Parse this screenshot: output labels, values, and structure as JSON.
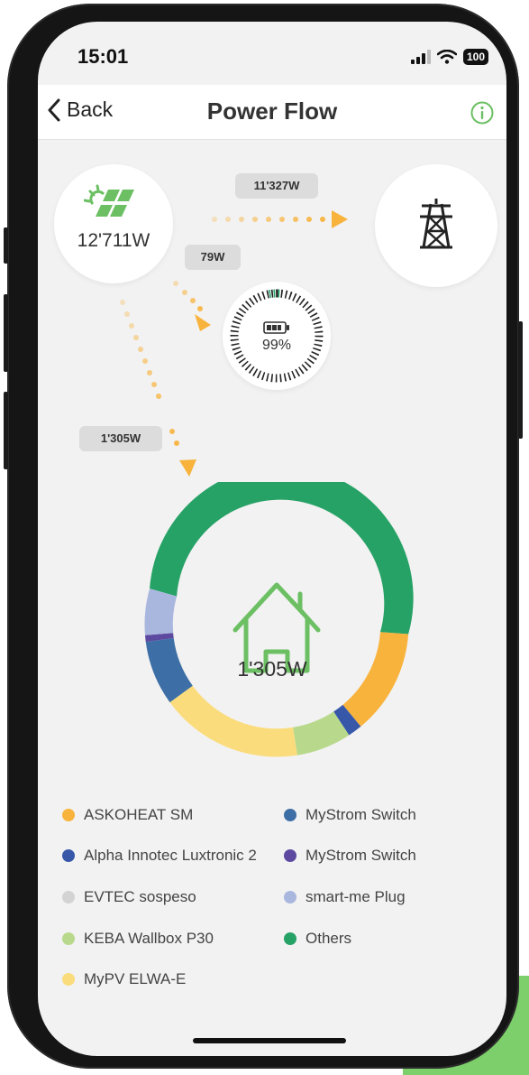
{
  "status_bar": {
    "time": "15:01",
    "battery": "100"
  },
  "nav": {
    "back_label": "Back",
    "title": "Power Flow"
  },
  "flow": {
    "solar_power": "12'711W",
    "to_grid": "11'327W",
    "to_battery": "79W",
    "to_house": "1'305W",
    "battery_level": "99%",
    "house_power": "1'305W"
  },
  "legend": {
    "askoheat": "ASKOHEAT SM",
    "alpha_innotec": "Alpha Innotec Luxtronic 2",
    "evtec": "EVTEC sospeso",
    "keba": "KEBA Wallbox P30",
    "mypv": "MyPV ELWA-E",
    "mystrom_1": "MyStrom Switch",
    "mystrom_2": "MyStrom Switch",
    "smartme": "smart-me Plug",
    "others": "Others"
  },
  "colors": {
    "askoheat": "#f8b33d",
    "alpha_innotec": "#3758a8",
    "evtec": "#d3d3d3",
    "keba": "#b8d98c",
    "mypv": "#fbdc7c",
    "mystrom_1": "#3d6fa6",
    "mystrom_2": "#5d4aa0",
    "smartme": "#a9b7df",
    "others": "#27a266",
    "flow_arrow": "#f8b33d",
    "house_icon": "#6cc063",
    "solar_icon": "#6cc063"
  },
  "icons": [
    "chevron-left-icon",
    "info-icon",
    "solar-panel-icon",
    "power-pylon-icon",
    "battery-icon",
    "house-icon"
  ]
}
